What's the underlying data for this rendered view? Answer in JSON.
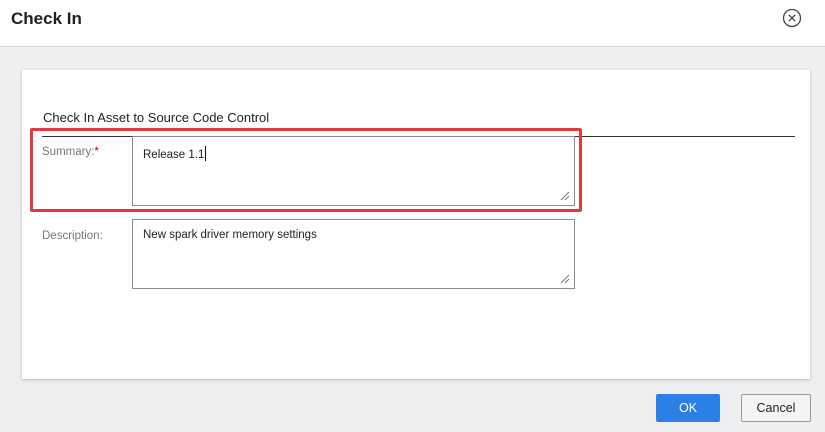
{
  "dialog": {
    "title": "Check In",
    "close_icon": "close-circle-icon"
  },
  "panel": {
    "heading": "Check In Asset to Source Code Control"
  },
  "summary": {
    "label": "Summary:",
    "required_marker": "*",
    "value": "Release 1.1",
    "has_caret": true,
    "highlighted": true,
    "highlight_color": "#e0393e"
  },
  "description": {
    "label": "Description:",
    "value": "New spark driver memory settings"
  },
  "footer": {
    "ok_label": "OK",
    "cancel_label": "Cancel",
    "ok_color": "#2d7fe8"
  }
}
